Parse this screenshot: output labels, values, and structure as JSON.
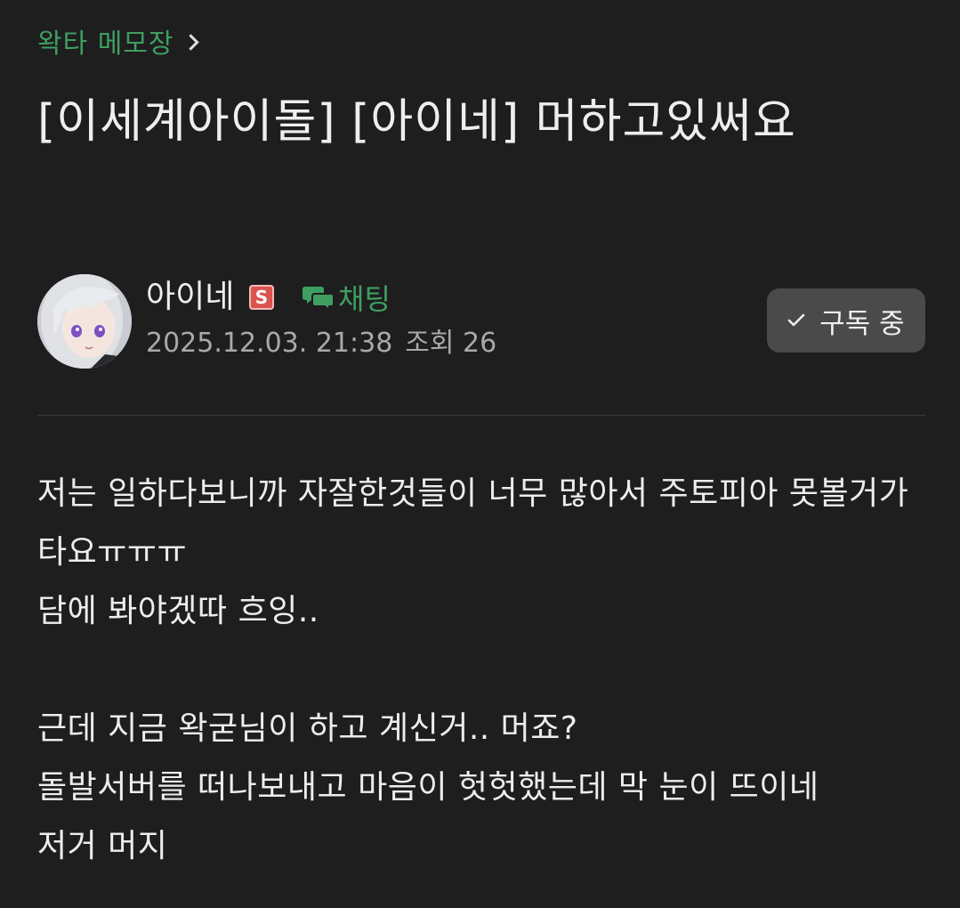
{
  "breadcrumb": {
    "label": "왁타 메모장"
  },
  "post": {
    "title": "[이세계아이돌] [아이네] 머하고있써요",
    "author": {
      "name": "아이네",
      "badge": "S",
      "chat_label": "채팅"
    },
    "date": "2025.12.03. 21:38",
    "views": "조회 26",
    "subscribe_label": "구독 중",
    "body": [
      "저는 일하다보니까 자잘한것들이 너무 많아서 주토피아 못볼거가타요ㅠㅠㅠ",
      "담에 봐야겠따 흐잉..",
      "",
      "근데 지금 왁굳님이 하고 계신거.. 머죠?",
      "돌발서버를 떠나보내고 마음이 헛헛했는데 막 눈이 뜨이네",
      "저거 머지"
    ]
  },
  "colors": {
    "background": "#1e1e1e",
    "accent_green": "#3f9e61",
    "badge_red": "#d9534f",
    "button_bg": "#4a4a4a"
  },
  "icons": {
    "breadcrumb": "chevron-right-icon",
    "chat": "chat-bubbles-icon",
    "subscribe": "check-icon"
  }
}
